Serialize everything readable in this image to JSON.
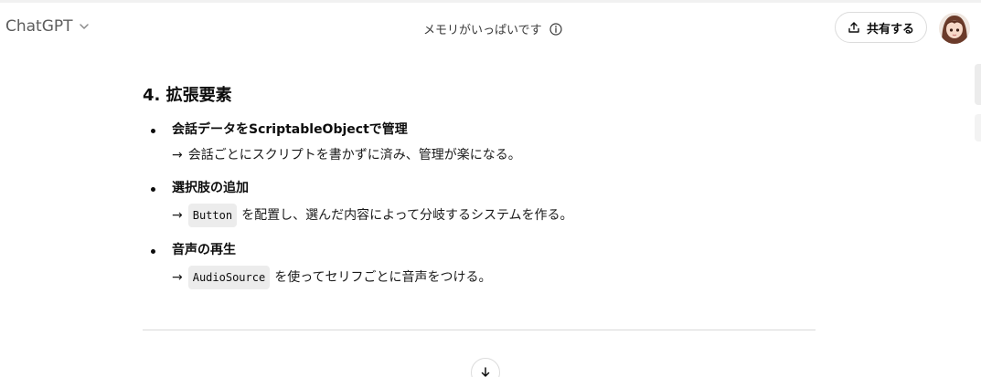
{
  "header": {
    "model_name": "ChatGPT",
    "memory_status": "メモリがいっぱいです",
    "share_label": "共有する"
  },
  "section": {
    "heading": "4. 拡張要素",
    "items": [
      {
        "title": "会話データをScriptableObjectで管理",
        "arrow": "→",
        "code": "",
        "text": "会話ごとにスクリプトを書かずに済み、管理が楽になる。"
      },
      {
        "title": "選択肢の追加",
        "arrow": "→",
        "code": "Button",
        "text": "を配置し、選んだ内容によって分岐するシステムを作る。"
      },
      {
        "title": "音声の再生",
        "arrow": "→",
        "code": "AudioSource",
        "text": "を使ってセリフごとに音声をつける。"
      }
    ]
  },
  "icons": {
    "chevron": "chevron-down-icon",
    "info": "info-icon",
    "share": "share-icon",
    "scroll_down": "arrow-down-icon"
  }
}
